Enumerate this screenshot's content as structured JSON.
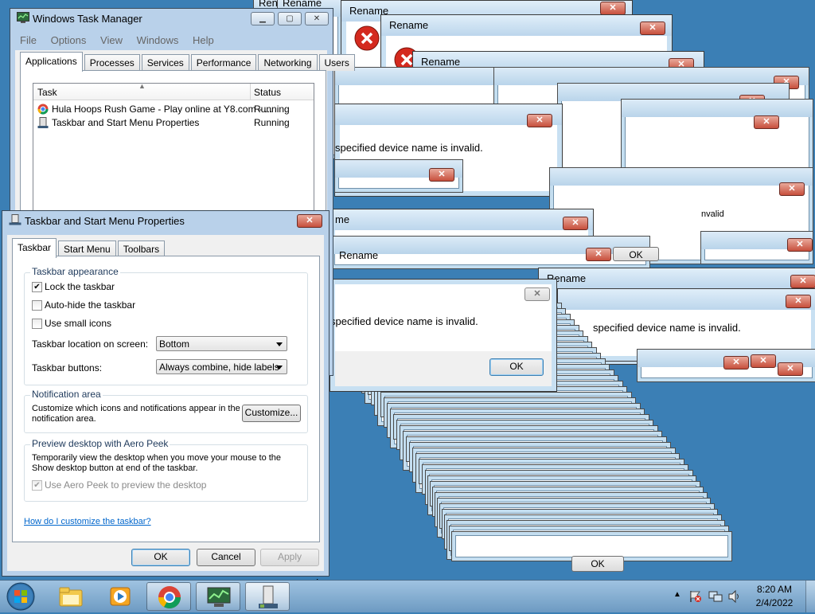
{
  "colors": {
    "desktop": "#3b7fb5",
    "window_frame": "#b9d1ea",
    "close_red": "#c74f3c",
    "link": "#0066cc"
  },
  "error_dialogs": {
    "title": "Rename",
    "message": "specified device name is invalid.",
    "message_full": "The specified device name is invalid.",
    "ok_label": "OK",
    "close_glyph": "✕",
    "frag_ren": "Ren",
    "frag_me": "me",
    "frag_nvalid": "nvalid",
    "frag_ok": "OK",
    "frag_rename_partial": "Rename"
  },
  "task_manager": {
    "title": "Windows Task Manager",
    "menu": [
      "File",
      "Options",
      "View",
      "Windows",
      "Help"
    ],
    "tabs": [
      "Applications",
      "Processes",
      "Services",
      "Performance",
      "Networking",
      "Users"
    ],
    "columns": {
      "task": "Task",
      "status": "Status"
    },
    "rows": [
      {
        "task": "Hula Hoops Rush Game - Play online at Y8.com - ...",
        "status": "Running",
        "icon": "chrome-icon"
      },
      {
        "task": "Taskbar and Start Menu Properties",
        "status": "Running",
        "icon": "taskbar-properties-icon"
      }
    ]
  },
  "taskbar_props": {
    "title": "Taskbar and Start Menu Properties",
    "tabs": [
      "Taskbar",
      "Start Menu",
      "Toolbars"
    ],
    "appearance": {
      "legend": "Taskbar appearance",
      "lock": {
        "label": "Lock the taskbar",
        "checked": true
      },
      "autohide": {
        "label": "Auto-hide the taskbar",
        "checked": false
      },
      "small_icons": {
        "label": "Use small icons",
        "checked": false
      },
      "location_label": "Taskbar location on screen:",
      "location_value": "Bottom",
      "buttons_label": "Taskbar buttons:",
      "buttons_value": "Always combine, hide labels"
    },
    "notification": {
      "legend": "Notification area",
      "text1": "Customize which icons and notifications appear in the",
      "text2": "notification area.",
      "customize_label": "Customize..."
    },
    "aero": {
      "legend": "Preview desktop with Aero Peek",
      "text1": "Temporarily view the desktop when you move your mouse to the",
      "text2": "Show desktop button at end of the taskbar.",
      "checkbox_label": "Use Aero Peek to preview the desktop",
      "checked": true
    },
    "help_link": "How do I customize the taskbar?",
    "buttons": {
      "ok": "OK",
      "cancel": "Cancel",
      "apply": "Apply"
    }
  },
  "taskbar": {
    "pinned": [
      "start-orb-icon",
      "explorer-folder-icon",
      "media-player-icon",
      "chrome-icon",
      "task-manager-icon",
      "taskbar-properties-icon"
    ],
    "clock": {
      "time": "8:20 AM",
      "date": "2/4/2022"
    },
    "tray": [
      "show-hidden-icons-arrow",
      "action-center-flag-icon",
      "network-icon",
      "volume-icon"
    ]
  }
}
